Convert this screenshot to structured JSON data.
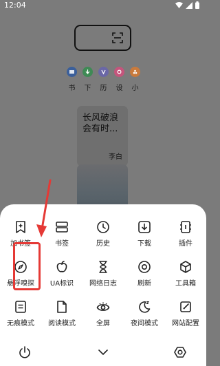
{
  "status_bar": {
    "time": "12:04"
  },
  "background": {
    "quick_links": [
      "书",
      "下",
      "历",
      "设",
      "小"
    ],
    "quick_link_colors": [
      "#3b5f9a",
      "#3f8a55",
      "#6a67a6",
      "#c4557c",
      "#c97a3c"
    ],
    "card": {
      "title": "长风破浪会有时...",
      "author": "李白"
    }
  },
  "menu": {
    "row1": [
      {
        "label": "加书签",
        "icon": "bookmark-add-icon"
      },
      {
        "label": "书签",
        "icon": "bookmarks-icon"
      },
      {
        "label": "历史",
        "icon": "history-clock-icon"
      },
      {
        "label": "下载",
        "icon": "download-icon"
      },
      {
        "label": "插件",
        "icon": "plugin-icon"
      }
    ],
    "row2": [
      {
        "label": "悬浮嗅探",
        "icon": "compass-icon"
      },
      {
        "label": "UA标识",
        "icon": "apple-icon"
      },
      {
        "label": "网络日志",
        "icon": "hourglass-icon"
      },
      {
        "label": "刷新",
        "icon": "refresh-icon"
      },
      {
        "label": "工具箱",
        "icon": "toolbox-icon"
      }
    ],
    "row3": [
      {
        "label": "无痕模式",
        "icon": "incognito-icon"
      },
      {
        "label": "阅读模式",
        "icon": "reading-mode-icon"
      },
      {
        "label": "全屏",
        "icon": "eye-icon"
      },
      {
        "label": "夜间模式",
        "icon": "moon-icon"
      },
      {
        "label": "网站配置",
        "icon": "site-settings-icon"
      }
    ]
  },
  "bottom_bar": {
    "left": "power-icon",
    "center": "chevron-down-icon",
    "right": "settings-hexagon-icon"
  },
  "annotation": {
    "highlight_color": "#e53935"
  }
}
